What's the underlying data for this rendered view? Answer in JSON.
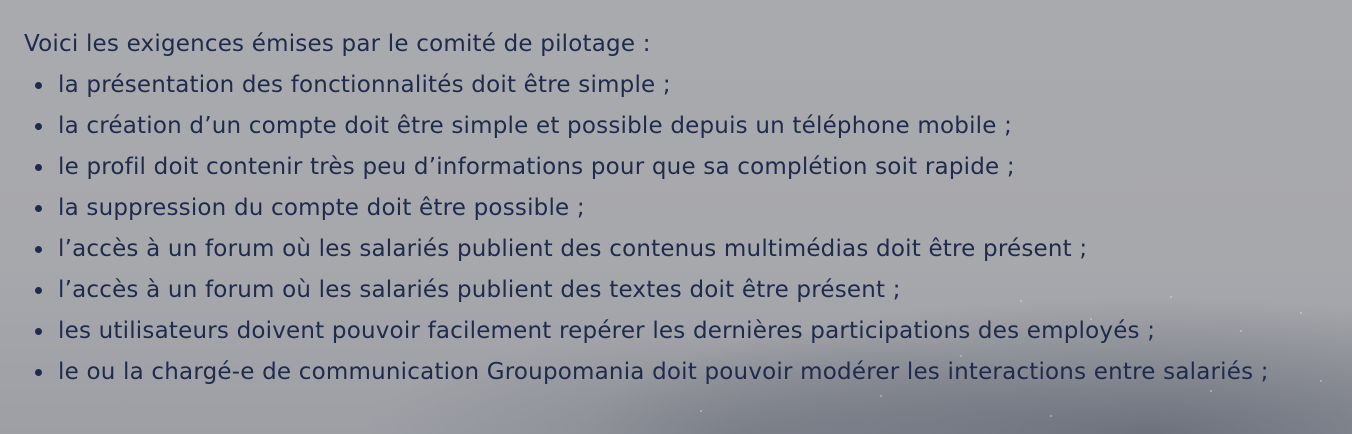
{
  "intro": "Voici les exigences émises par le comité de pilotage :",
  "items": [
    "la présentation des fonctionnalités doit être simple ;",
    "la création d’un compte doit être simple et possible depuis un téléphone mobile ;",
    "le profil doit contenir très peu d’informations pour que sa complétion soit rapide ;",
    "la suppression du compte doit être possible ;",
    "l’accès à un forum où les salariés publient des contenus multimédias doit être présent ;",
    "l’accès à un forum où les salariés publient des textes doit être présent ;",
    "les utilisateurs doivent pouvoir facilement repérer les dernières participations des employés ;",
    "le ou la chargé-e de communication Groupomania doit pouvoir modérer les interactions entre salariés ;"
  ],
  "colors": {
    "text": "#1f2b4d",
    "background": "#a8a9ad"
  }
}
